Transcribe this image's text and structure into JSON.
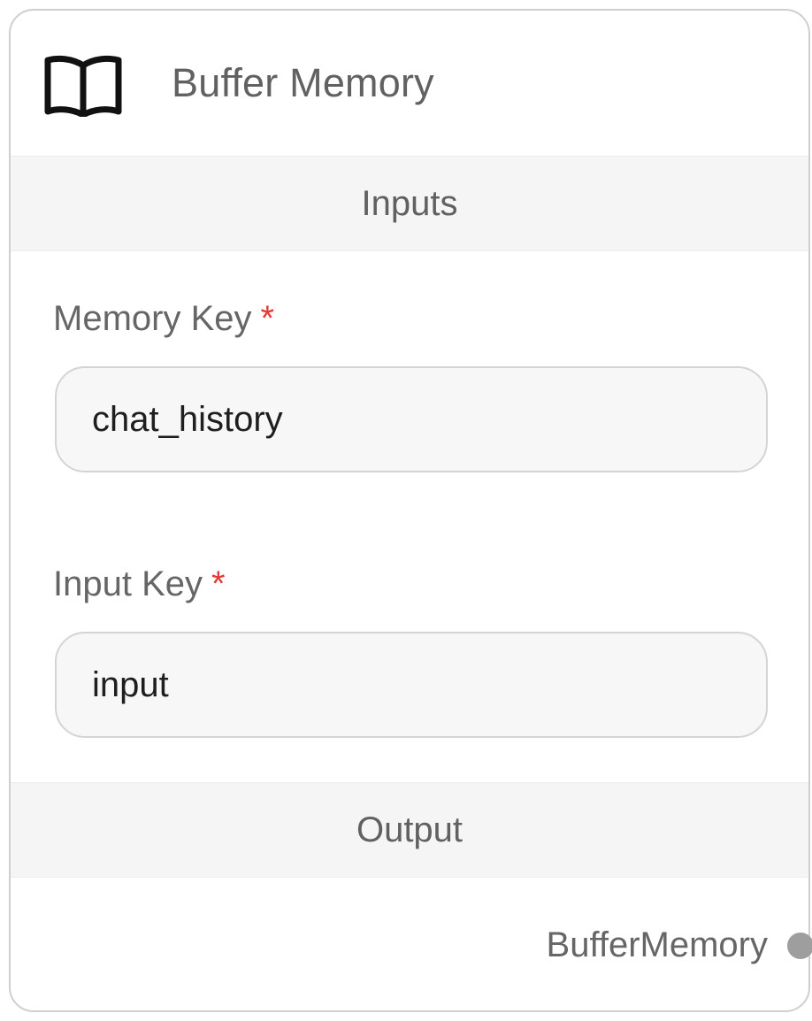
{
  "node": {
    "title": "Buffer Memory",
    "icon": "book-icon"
  },
  "inputs_section": {
    "label": "Inputs",
    "fields": [
      {
        "label": "Memory Key",
        "required_mark": "*",
        "value": "chat_history"
      },
      {
        "label": "Input Key",
        "required_mark": "*",
        "value": "input"
      }
    ]
  },
  "output_section": {
    "label": "Output",
    "output_name": "BufferMemory"
  },
  "colors": {
    "required": "#e53935",
    "handle": "#9e9e9e",
    "section_bg": "#f5f5f5"
  }
}
